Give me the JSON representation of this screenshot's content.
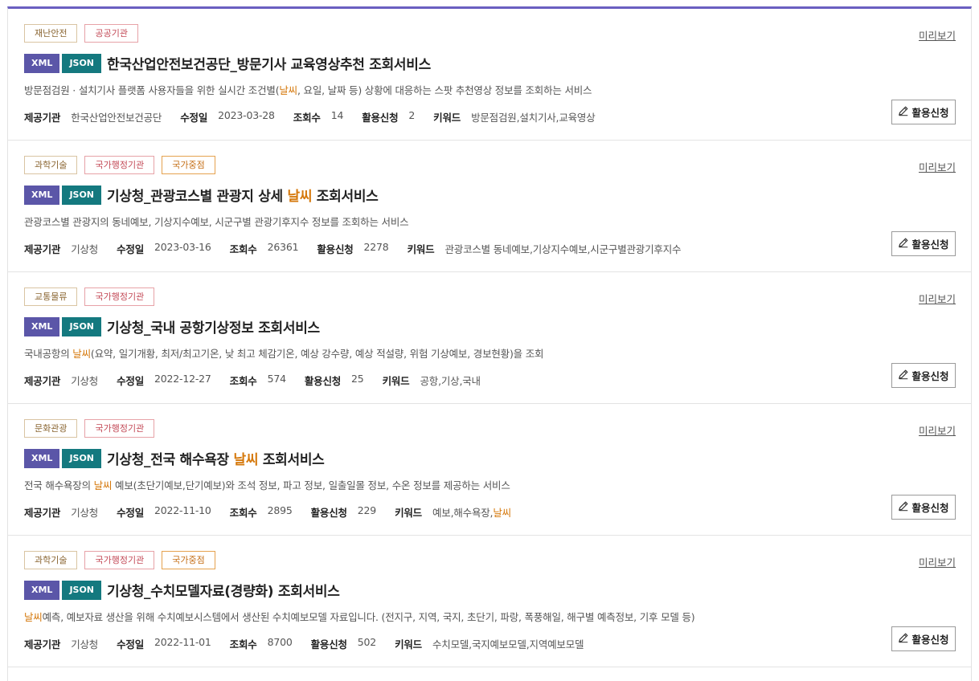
{
  "items": [
    {
      "tags": [
        {
          "label": "재난안전",
          "style": "brown"
        },
        {
          "label": "공공기관",
          "style": "red"
        }
      ],
      "formats": [
        "XML",
        "JSON"
      ],
      "title": [
        {
          "text": "한국산업안전보건공단_방문기사 교육영상추천 조회서비스",
          "hl": false
        }
      ],
      "desc": [
        {
          "text": "방문점검원 · 설치기사 플랫폼 사용자들을 위한 실시간 조건별(",
          "hl": false
        },
        {
          "text": "날씨",
          "hl": true
        },
        {
          "text": ", 요일, 날짜 등) 상황에 대응하는 스팟 추천영상 정보를 조회하는 서비스",
          "hl": false
        }
      ],
      "provider_label": "제공기관",
      "provider": "한국산업안전보건공단",
      "modified_label": "수정일",
      "modified": "2023-03-28",
      "views_label": "조회수",
      "views": "14",
      "apps_label": "활용신청",
      "apps": "2",
      "keywords_label": "키워드",
      "keywords": [
        {
          "text": "방문점검원,설치기사,교육영상",
          "hl": false
        }
      ],
      "preview_label": "미리보기",
      "apply_label": "활용신청"
    },
    {
      "tags": [
        {
          "label": "과학기술",
          "style": "brown"
        },
        {
          "label": "국가행정기관",
          "style": "red"
        },
        {
          "label": "국가중점",
          "style": "orange"
        }
      ],
      "formats": [
        "XML",
        "JSON"
      ],
      "title": [
        {
          "text": "기상청_관광코스별 관광지 상세 ",
          "hl": false
        },
        {
          "text": "날씨",
          "hl": true
        },
        {
          "text": " 조회서비스",
          "hl": false
        }
      ],
      "desc": [
        {
          "text": "관광코스별 관광지의 동네예보, 기상지수예보, 시군구별 관광기후지수 정보를 조회하는 서비스",
          "hl": false
        }
      ],
      "provider_label": "제공기관",
      "provider": "기상청",
      "modified_label": "수정일",
      "modified": "2023-03-16",
      "views_label": "조회수",
      "views": "26361",
      "apps_label": "활용신청",
      "apps": "2278",
      "keywords_label": "키워드",
      "keywords": [
        {
          "text": "관광코스별 동네예보,기상지수예보,시군구별관광기후지수",
          "hl": false
        }
      ],
      "preview_label": "미리보기",
      "apply_label": "활용신청"
    },
    {
      "tags": [
        {
          "label": "교통물류",
          "style": "brown"
        },
        {
          "label": "국가행정기관",
          "style": "red"
        }
      ],
      "formats": [
        "XML",
        "JSON"
      ],
      "title": [
        {
          "text": "기상청_국내 공항기상정보 조회서비스",
          "hl": false
        }
      ],
      "desc": [
        {
          "text": "국내공항의 ",
          "hl": false
        },
        {
          "text": "날씨",
          "hl": true
        },
        {
          "text": "(요약, 일기개황, 최저/최고기온, 낮 최고 체감기온, 예상 강수량, 예상 적설량, 위험 기상예보, 경보현황)을 조회",
          "hl": false
        }
      ],
      "provider_label": "제공기관",
      "provider": "기상청",
      "modified_label": "수정일",
      "modified": "2022-12-27",
      "views_label": "조회수",
      "views": "574",
      "apps_label": "활용신청",
      "apps": "25",
      "keywords_label": "키워드",
      "keywords": [
        {
          "text": "공항,기상,국내",
          "hl": false
        }
      ],
      "preview_label": "미리보기",
      "apply_label": "활용신청"
    },
    {
      "tags": [
        {
          "label": "문화관광",
          "style": "brown"
        },
        {
          "label": "국가행정기관",
          "style": "red"
        }
      ],
      "formats": [
        "XML",
        "JSON"
      ],
      "title": [
        {
          "text": "기상청_전국 해수욕장 ",
          "hl": false
        },
        {
          "text": "날씨",
          "hl": true
        },
        {
          "text": " 조회서비스",
          "hl": false
        }
      ],
      "desc": [
        {
          "text": "전국 해수욕장의 ",
          "hl": false
        },
        {
          "text": "날씨",
          "hl": true
        },
        {
          "text": " 예보(초단기예보,단기예보)와 조석 정보, 파고 정보, 일출일몰 정보, 수온 정보를 제공하는 서비스",
          "hl": false
        }
      ],
      "provider_label": "제공기관",
      "provider": "기상청",
      "modified_label": "수정일",
      "modified": "2022-11-10",
      "views_label": "조회수",
      "views": "2895",
      "apps_label": "활용신청",
      "apps": "229",
      "keywords_label": "키워드",
      "keywords": [
        {
          "text": "예보,해수욕장,",
          "hl": false
        },
        {
          "text": "날씨",
          "hl": true
        }
      ],
      "preview_label": "미리보기",
      "apply_label": "활용신청"
    },
    {
      "tags": [
        {
          "label": "과학기술",
          "style": "brown"
        },
        {
          "label": "국가행정기관",
          "style": "red"
        },
        {
          "label": "국가중점",
          "style": "orange"
        }
      ],
      "formats": [
        "XML",
        "JSON"
      ],
      "title": [
        {
          "text": "기상청_수치모델자료(경량화) 조회서비스",
          "hl": false
        }
      ],
      "desc": [
        {
          "text": "날씨",
          "hl": true
        },
        {
          "text": "예측, 예보자료 생산을 위해 수치예보시스템에서 생산된 수치예보모델 자료입니다. (전지구, 지역, 국지, 초단기, 파랑, 폭풍해일, 해구별 예측정보, 기후 모델 등)",
          "hl": false
        }
      ],
      "provider_label": "제공기관",
      "provider": "기상청",
      "modified_label": "수정일",
      "modified": "2022-11-01",
      "views_label": "조회수",
      "views": "8700",
      "apps_label": "활용신청",
      "apps": "502",
      "keywords_label": "키워드",
      "keywords": [
        {
          "text": "수치모델,국지예보모델,지역예보모델",
          "hl": false
        }
      ],
      "preview_label": "미리보기",
      "apply_label": "활용신청"
    }
  ]
}
